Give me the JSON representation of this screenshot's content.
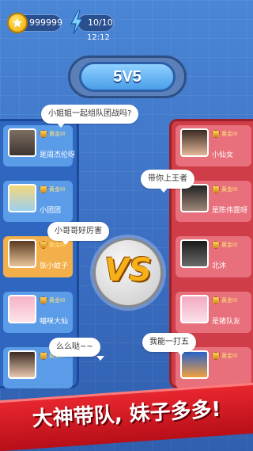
{
  "top": {
    "coins": "999999",
    "energy": "10/10",
    "timer": "12:12"
  },
  "mode": {
    "label": "5V5"
  },
  "left_team": [
    {
      "rank": "黄金III",
      "name": "是周杰伦呀"
    },
    {
      "rank": "黄金III",
      "name": "小团团"
    },
    {
      "rank": "黄金III",
      "name": "张小蚊子"
    },
    {
      "rank": "黄金III",
      "name": "喵咪大仙"
    },
    {
      "rank": "黄金III",
      "name": ""
    }
  ],
  "right_team": [
    {
      "rank": "黄金III",
      "name": "小仙女"
    },
    {
      "rank": "黄金III",
      "name": "是陈伟霆呀"
    },
    {
      "rank": "黄金III",
      "name": "北沐"
    },
    {
      "rank": "黄金III",
      "name": "是猪队友"
    },
    {
      "rank": "黄金III",
      "name": ""
    }
  ],
  "bubbles": {
    "b1": "小姐姐一起组队团战吗?",
    "b2": "带你上王者",
    "b3": "小哥哥好厉害",
    "b4": "么么哒~~",
    "b5": "我能一打五"
  },
  "vs": "VS",
  "footer": "大神带队, 妹子多多!",
  "colors": {
    "blue_team": "#2f67c0",
    "red_team": "#cf3d48",
    "gold": "#f6b019"
  }
}
